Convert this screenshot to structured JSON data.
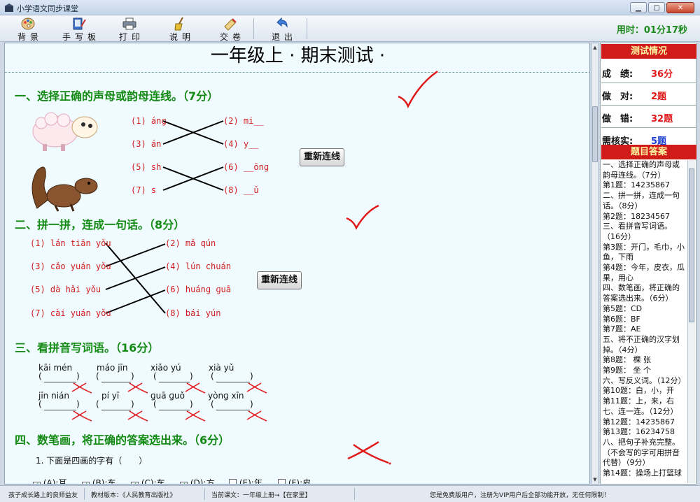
{
  "window": {
    "title": "小学语文同步课堂",
    "minimize": "▁",
    "maximize": "▢",
    "close": "✕"
  },
  "toolbar": {
    "buttons": [
      {
        "label": "背景",
        "icon": "palette-icon"
      },
      {
        "label": "手写板",
        "icon": "handwriting-pad-icon"
      },
      {
        "label": "打印",
        "icon": "printer-icon"
      },
      {
        "label": "说明",
        "icon": "help-broom-icon"
      },
      {
        "label": "交卷",
        "icon": "submit-paper-icon"
      },
      {
        "label": "退出",
        "icon": "back-arrow-icon"
      }
    ],
    "timer": "用时：01分17秒"
  },
  "test": {
    "title": "一年级上 · 期末测试 ·",
    "section1": {
      "title": "一、选择正确的声母或韵母连线。（7分）",
      "left": [
        "(1) ánɡ",
        "(3) án",
        "(5) sh",
        "(7) s"
      ],
      "right": [
        "(2) mi__",
        "(4) y__",
        "(6) __ōnɡ",
        "(8) __ǔ"
      ],
      "reset": "重新连线"
    },
    "section2": {
      "title": "二、拼一拼，连成一句话。（8分）",
      "left": [
        "(1) lán tiān yǒu",
        "(3) cǎo yuán yǒu",
        "(5) dà hǎi yǒu",
        "(7) cài yuán yǒu"
      ],
      "right": [
        "(2) mǎ  qún",
        "(4) lún chuán",
        "(6) huánɡ ɡuā",
        "(8) bái  yún"
      ],
      "reset": "重新连线"
    },
    "section3": {
      "title": "三、看拼音写词语。（16分）",
      "row1": [
        "kāi  mén",
        "máo jīn",
        "xiǎo yú",
        "xià yǔ"
      ],
      "row2": [
        "jīn nián",
        "pí yī",
        "ɡuā ɡuǒ",
        "yònɡ xīn"
      ],
      "open": "(",
      "close": ")"
    },
    "section4": {
      "title": "四、数笔画，将正确的答案选出来。（6分）",
      "question": "1. 下面是四画的字有（　　）",
      "options": [
        {
          "label": "(A):耳",
          "checked": true
        },
        {
          "label": "(B):东",
          "checked": true
        },
        {
          "label": "(C):车",
          "checked": true
        },
        {
          "label": "(D):方",
          "checked": true
        },
        {
          "label": "(E):年",
          "checked": false
        },
        {
          "label": "(F):皮",
          "checked": false
        }
      ]
    }
  },
  "sidebar": {
    "status_title": "测试情况",
    "score_label": "成　绩:",
    "score_value": "36分",
    "correct_label": "做　对:",
    "correct_value": "2题",
    "wrong_label": "做　错:",
    "wrong_value": "32题",
    "review_label": "需核实:",
    "review_value": "5题",
    "answers_title": "题目答案",
    "answers": [
      "一、选择正确的声母或韵母连线。（7分）",
      "第1题：14235867",
      "二、拼一拼，连成一句话。（8分）",
      "第2题：18234567",
      "三、看拼音写词语。（16分）",
      "第3题：开门，毛巾，小鱼，下雨",
      "第4题：今年，皮衣，瓜果，用心",
      "四、数笔画，将正确的答案选出来。（6分）",
      "第5题：CD",
      "第6题：BF",
      "第7题：AE",
      "五、将不正确的汉字划掉。（4分）",
      "第8题： 棵 张",
      "第9题： 坐 个",
      "六、写反义词。（12分）",
      "第10题：白，小，开",
      "第11题：上，来，右",
      "七、连一连。（12分）",
      "第12题：14235867",
      "第13题：16234758",
      "八、把句子补充完整。（不会写的字可用拼音代替）（9分）",
      "第14题：操场上打篮球"
    ]
  },
  "statusbar": {
    "slogan": "孩子成长路上的良师益友",
    "edition": "教材版本：《人民教育出版社》",
    "lesson": "当前课文：一年级上册→【在家里】",
    "notice": "您是免费版用户，注册为VIP用户后全部功能开放，无任何限制！"
  },
  "colors": {
    "section_title": "#138a13",
    "item_text": "#d21c1c",
    "header_bg": "#d11a1a",
    "timer": "#1d8a1d"
  }
}
